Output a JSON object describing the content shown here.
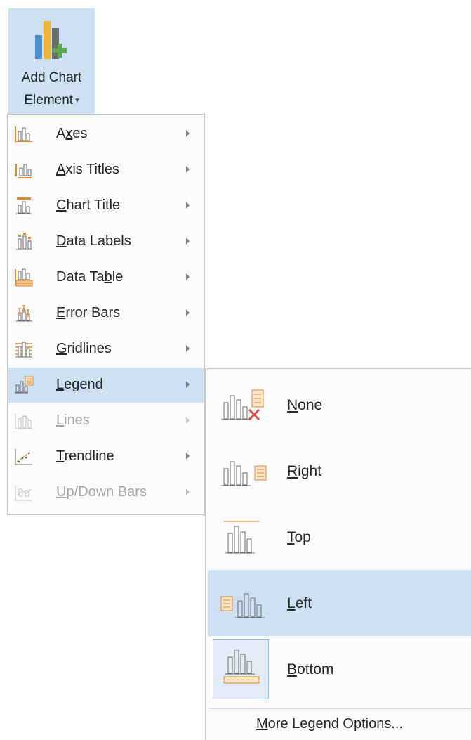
{
  "ribbon_button": {
    "line1": "Add Chart",
    "line2": "Element",
    "caret": "▾",
    "icon": "add-chart-element-icon"
  },
  "menu": {
    "items": [
      {
        "pre": "A",
        "u": "x",
        "post": "es",
        "icon": "axes-icon",
        "disabled": false
      },
      {
        "pre": "",
        "u": "A",
        "post": "xis Titles",
        "icon": "axis-titles-icon",
        "disabled": false
      },
      {
        "pre": "",
        "u": "C",
        "post": "hart Title",
        "icon": "chart-title-icon",
        "disabled": false
      },
      {
        "pre": "",
        "u": "D",
        "post": "ata Labels",
        "icon": "data-labels-icon",
        "disabled": false
      },
      {
        "pre": "Data Ta",
        "u": "b",
        "post": "le",
        "icon": "data-table-icon",
        "disabled": false
      },
      {
        "pre": "",
        "u": "E",
        "post": "rror Bars",
        "icon": "error-bars-icon",
        "disabled": false
      },
      {
        "pre": "",
        "u": "G",
        "post": "ridlines",
        "icon": "gridlines-icon",
        "disabled": false
      },
      {
        "pre": "",
        "u": "L",
        "post": "egend",
        "icon": "legend-icon",
        "disabled": false,
        "highlighted": true
      },
      {
        "pre": "",
        "u": "L",
        "post": "ines",
        "icon": "lines-icon",
        "disabled": true
      },
      {
        "pre": "",
        "u": "T",
        "post": "rendline",
        "icon": "trendline-icon",
        "disabled": false
      },
      {
        "pre": "",
        "u": "U",
        "post": "p/Down Bars",
        "icon": "up-down-bars-icon",
        "disabled": true
      }
    ]
  },
  "submenu": {
    "items": [
      {
        "u": "N",
        "post": "one",
        "icon": "legend-none-icon"
      },
      {
        "u": "R",
        "post": "ight",
        "icon": "legend-right-icon"
      },
      {
        "u": "T",
        "post": "op",
        "icon": "legend-top-icon"
      },
      {
        "u": "L",
        "post": "eft",
        "icon": "legend-left-icon",
        "highlighted": true
      },
      {
        "u": "B",
        "post": "ottom",
        "icon": "legend-bottom-icon",
        "selected": true
      }
    ],
    "more": {
      "u": "M",
      "post": "ore Legend Options..."
    }
  },
  "colors": {
    "highlight": "#cde0f4",
    "orange": "#e08a2e",
    "icon_gray": "#6b6b6b",
    "green": "#5aab4b",
    "red": "#e04b3a"
  }
}
